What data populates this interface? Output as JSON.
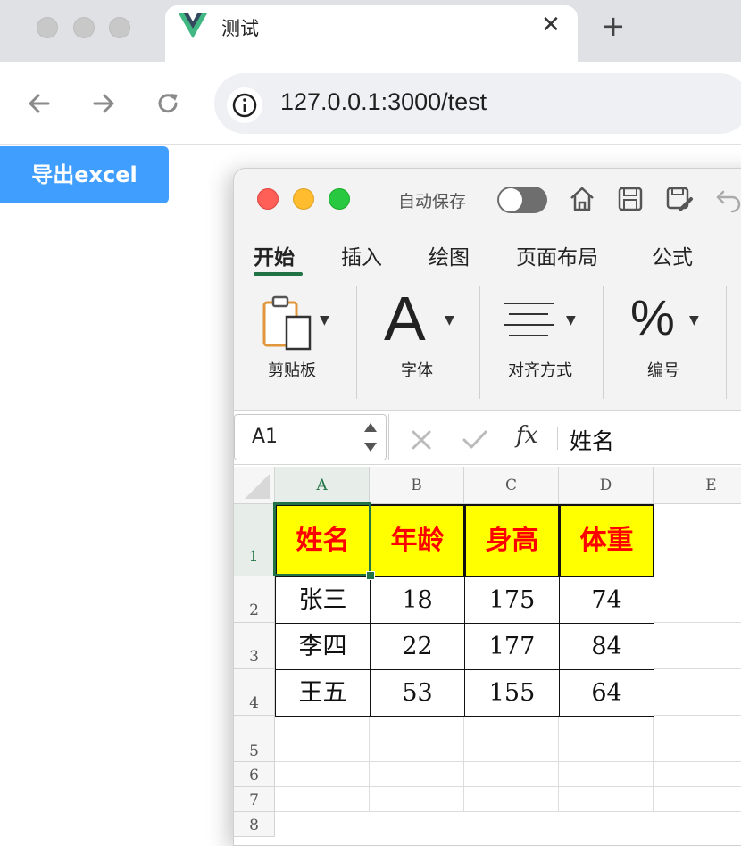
{
  "browser": {
    "tab_title": "测试",
    "tab_close": "✕",
    "new_tab": "+",
    "url": "127.0.0.1:3000/test"
  },
  "page": {
    "export_label": "导出excel"
  },
  "excel": {
    "autosave_label": "自动保存",
    "ribbon_tabs": [
      "开始",
      "插入",
      "绘图",
      "页面布局",
      "公式"
    ],
    "groups": [
      "剪贴板",
      "字体",
      "对齐方式",
      "编号"
    ],
    "font_glyph": "A",
    "percent_glyph": "%",
    "name_box": "A1",
    "fx_label": "fx",
    "formula_value": "姓名",
    "columns": [
      "A",
      "B",
      "C",
      "D",
      "E"
    ],
    "rows": [
      "1",
      "2",
      "3",
      "4",
      "5",
      "6",
      "7",
      "8"
    ],
    "table": {
      "header": [
        "姓名",
        "年龄",
        "身高",
        "体重"
      ],
      "data": [
        [
          "张三",
          "18",
          "175",
          "74"
        ],
        [
          "李四",
          "22",
          "177",
          "84"
        ],
        [
          "王五",
          "53",
          "155",
          "64"
        ]
      ]
    },
    "colors": {
      "accent": "#217346",
      "header_fill": "#ffff00",
      "header_text": "#ff0000",
      "button": "#409eff"
    }
  }
}
